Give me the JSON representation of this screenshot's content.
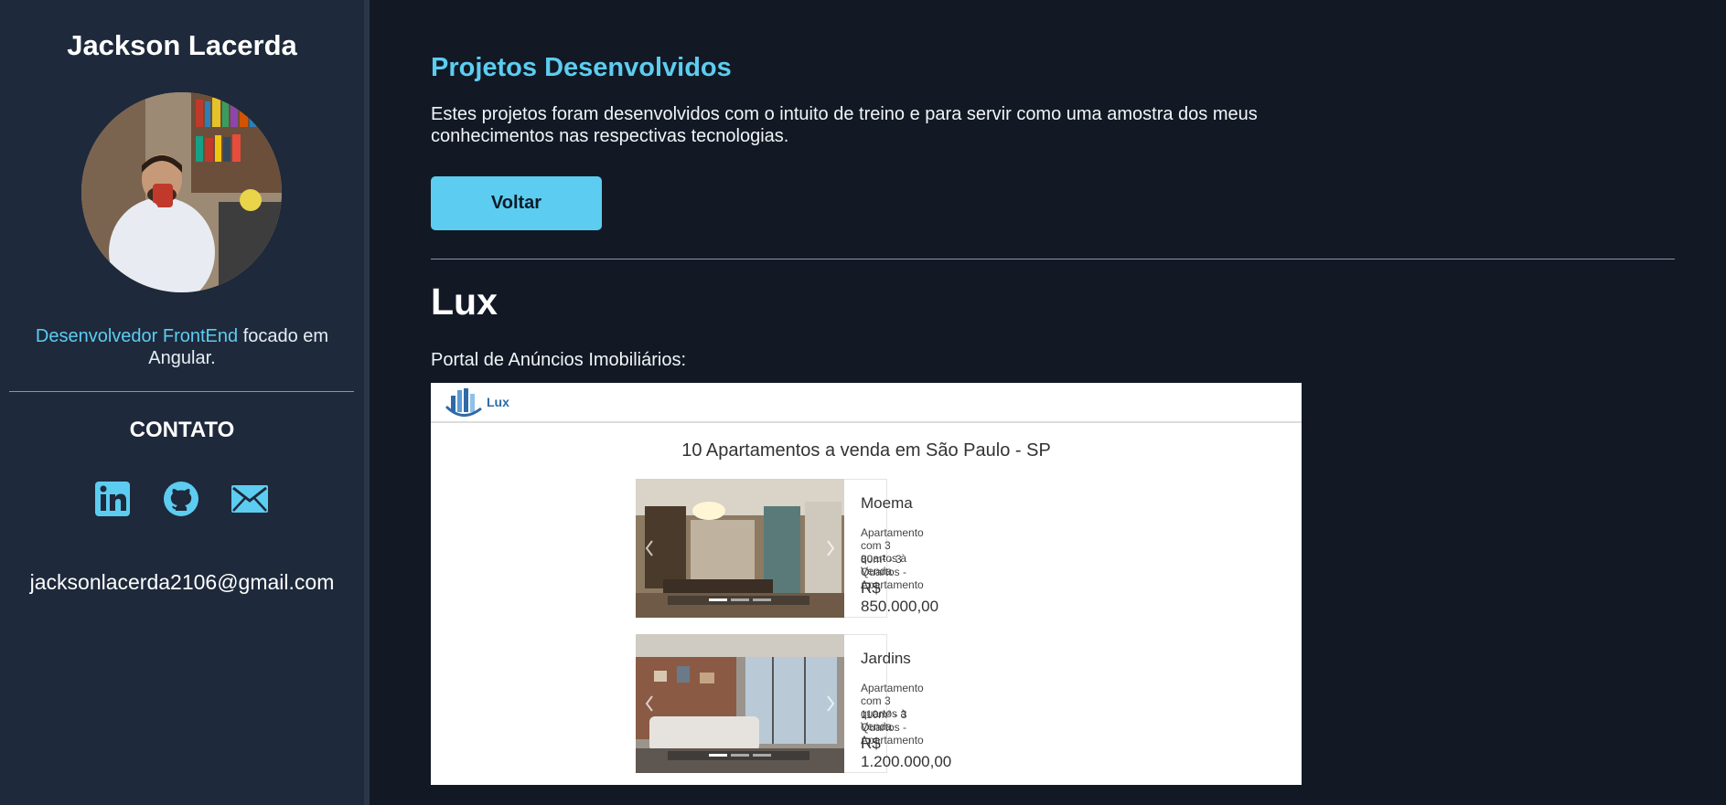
{
  "sidebar": {
    "name": "Jackson Lacerda",
    "bio_accent": "Desenvolvedor FrontEnd",
    "bio_rest": " focado em Angular.",
    "contact_title": "CONTATO",
    "email": "jacksonlacerda2106@gmail.com",
    "social_icons": [
      "linkedin-icon",
      "github-icon",
      "mail-icon"
    ]
  },
  "main": {
    "title": "Projetos Desenvolvidos",
    "description": "Estes projetos foram desenvolvidos com o intuito de treino e para servir como uma amostra dos meus conhecimentos nas respectivas tecnologias.",
    "back_button": "Voltar"
  },
  "project": {
    "name": "Lux",
    "description": "Portal de Anúncios Imobiliários:",
    "screenshot": {
      "logo_text": "Lux",
      "heading": "10 Apartamentos a venda em São Paulo - SP",
      "listings": [
        {
          "title": "Moema",
          "subtitle": "Apartamento com 3 quartos à Venda",
          "details": "80m² - 3 Quartos - Apartamento",
          "price": "R$ 850.000,00"
        },
        {
          "title": "Jardins",
          "subtitle": "Apartamento com 3 quartos à Venda",
          "details": "110m² - 3 Quartos - Apartamento",
          "price": "R$ 1.200.000,00"
        }
      ]
    }
  },
  "colors": {
    "accent": "#5ccdf0",
    "background": "#121924",
    "sidebar": "#1e293b"
  }
}
